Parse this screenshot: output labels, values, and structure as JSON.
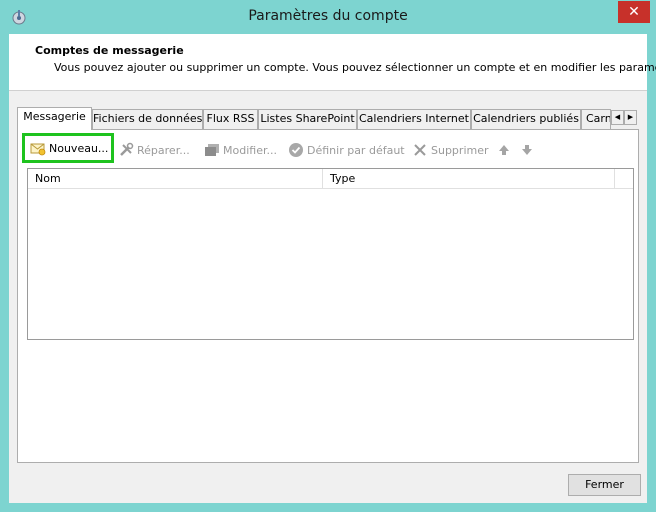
{
  "window": {
    "title": "Paramètres du compte",
    "close_glyph": "✕"
  },
  "header": {
    "title": "Comptes de messagerie",
    "description": "Vous pouvez ajouter ou supprimer un compte. Vous pouvez sélectionner un compte et en modifier les paramètres."
  },
  "tabs": {
    "items": [
      {
        "label": "Messagerie"
      },
      {
        "label": "Fichiers de données"
      },
      {
        "label": "Flux RSS"
      },
      {
        "label": "Listes SharePoint"
      },
      {
        "label": "Calendriers Internet"
      },
      {
        "label": "Calendriers publiés"
      },
      {
        "label": "Carn"
      }
    ],
    "active": "Messagerie"
  },
  "toolbar": {
    "new_label": "Nouveau...",
    "repair_label": "Réparer...",
    "modify_label": "Modifier...",
    "default_label": "Définir par défaut",
    "delete_label": "Supprimer"
  },
  "grid": {
    "columns": [
      "Nom",
      "Type"
    ],
    "rows": []
  },
  "footer": {
    "close_label": "Fermer"
  },
  "colors": {
    "highlight": "#1ec31e",
    "close_red": "#c7312a",
    "chrome": "#7dd4d0"
  }
}
